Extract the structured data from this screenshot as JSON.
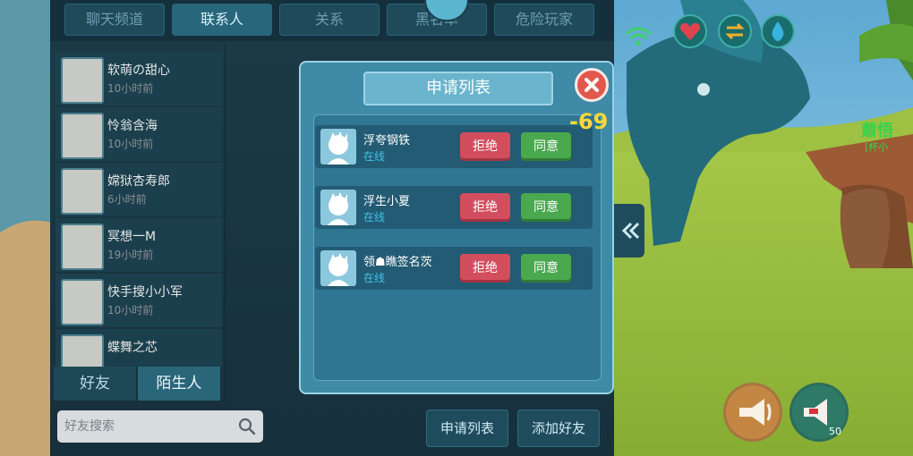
{
  "tabs": [
    "聊天频道",
    "联系人",
    "关系",
    "黑名单",
    "危险玩家"
  ],
  "active_tab_index": 1,
  "contacts": [
    {
      "name": "软萌の甜心",
      "time": "10小时前"
    },
    {
      "name": "怜翁含海",
      "time": "10小时前"
    },
    {
      "name": "嫦狱杏寿郎",
      "time": "6小时前"
    },
    {
      "name": "冥想一M",
      "time": "19小时前"
    },
    {
      "name": "快手搜小小军",
      "time": "10小时前"
    },
    {
      "name": "蝶舞之芯",
      "time": ""
    }
  ],
  "subtabs": {
    "friends": "好友",
    "strangers": "陌生人",
    "active": "strangers"
  },
  "search": {
    "placeholder": "好友搜索"
  },
  "bottom_buttons": {
    "request_list": "申请列表",
    "add_friend": "添加好友"
  },
  "dialog": {
    "title": "申请列表",
    "requests": [
      {
        "name": "浮夸钢铁",
        "status": "在线",
        "reject": "拒绝",
        "agree": "同意"
      },
      {
        "name": "浮生小夏",
        "status": "在线",
        "reject": "拒绝",
        "agree": "同意"
      },
      {
        "name": "领☗瞧签名茨",
        "status": "在线",
        "reject": "拒绝",
        "agree": "同意"
      }
    ]
  },
  "hud": {
    "score": "-69",
    "player_label": "蕭悟",
    "player_sub": "[杯小",
    "speaker_count": "50",
    "icons": [
      "wifi-icon",
      "heart-icon",
      "swap-icon",
      "drop-icon",
      "megaphone-icon",
      "speaker-icon"
    ]
  },
  "colors": {
    "accent": "#3f8aa6",
    "reject": "#d24e5e",
    "agree": "#4aa84f",
    "online": "#45c1ea",
    "score": "#ffd83a"
  }
}
